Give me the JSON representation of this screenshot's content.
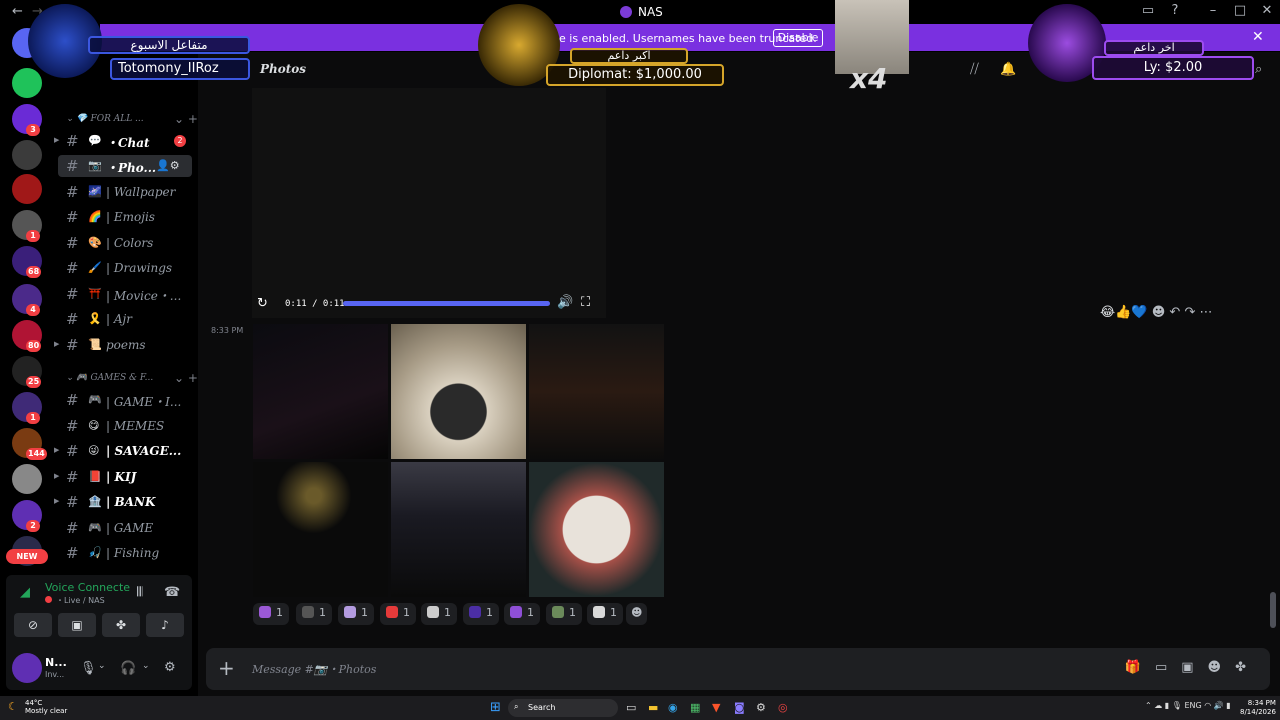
{
  "window": {
    "title": "NAS",
    "back": "←",
    "forward": "→"
  },
  "banner": {
    "text": "e is enabled. Usernames have been truncated.",
    "button": "Disable"
  },
  "rail": {
    "servers": [
      {
        "color": "#5865f2",
        "badge": ""
      },
      {
        "color": "#1fc25a",
        "badge": ""
      },
      {
        "color": "#6a2bd6",
        "badge": "3"
      },
      {
        "color": "#3b3b3b",
        "badge": ""
      },
      {
        "color": "#a01818",
        "badge": ""
      },
      {
        "color": "#555555",
        "badge": "1"
      },
      {
        "color": "#3a1f7a",
        "badge": "68"
      },
      {
        "color": "#4b2a8a",
        "badge": "4"
      },
      {
        "color": "#b01434",
        "badge": "80"
      },
      {
        "color": "#222222",
        "badge": "25"
      },
      {
        "color": "#3f2a77",
        "badge": "1"
      },
      {
        "color": "#7a3b12",
        "badge": "144"
      },
      {
        "color": "#888888",
        "badge": ""
      },
      {
        "color": "#5f2fb3",
        "badge": "2"
      },
      {
        "color": "#2a2a4a",
        "badge": ""
      }
    ],
    "new_label": "NEW"
  },
  "sidebar": {
    "cat1": "FOR ALL ...",
    "cat2": "GAMES & F...",
    "channels": [
      {
        "emoji": "💬",
        "name": "・Chat",
        "bold": true,
        "badge": "2",
        "active": false,
        "arrow": true
      },
      {
        "emoji": "📷",
        "name": "・Pho...",
        "bold": true,
        "badge": "",
        "active": true,
        "arrow": false
      },
      {
        "emoji": "🌌",
        "name": "| Wallpaper",
        "bold": false,
        "badge": "",
        "active": false,
        "arrow": false
      },
      {
        "emoji": "🌈",
        "name": "| Emojis",
        "bold": false,
        "badge": "",
        "active": false,
        "arrow": false
      },
      {
        "emoji": "🎨",
        "name": "| Colors",
        "bold": false,
        "badge": "",
        "active": false,
        "arrow": false
      },
      {
        "emoji": "🖌️",
        "name": "| Drawings",
        "bold": false,
        "badge": "",
        "active": false,
        "arrow": false
      },
      {
        "emoji": "⛩️",
        "name": "| Movice・...",
        "bold": false,
        "badge": "",
        "active": false,
        "arrow": false
      },
      {
        "emoji": "🎗️",
        "name": "| Ajr",
        "bold": false,
        "badge": "",
        "active": false,
        "arrow": false
      },
      {
        "emoji": "📜",
        "name": "poems",
        "bold": false,
        "badge": "",
        "active": false,
        "arrow": true
      },
      {
        "emoji": "🎮",
        "name": "| GAME・I...",
        "bold": false,
        "badge": "",
        "active": false,
        "arrow": false
      },
      {
        "emoji": "😋",
        "name": "| MEMES",
        "bold": false,
        "badge": "",
        "active": false,
        "arrow": false
      },
      {
        "emoji": "😜",
        "name": "| SAVAGE...",
        "bold": true,
        "badge": "",
        "active": false,
        "arrow": true
      },
      {
        "emoji": "📕",
        "name": "| KIJ",
        "bold": true,
        "badge": "",
        "active": false,
        "arrow": true
      },
      {
        "emoji": "🏦",
        "name": "| BANK",
        "bold": true,
        "badge": "",
        "active": false,
        "arrow": true
      },
      {
        "emoji": "🎮",
        "name": "| GAME",
        "bold": false,
        "badge": "",
        "active": false,
        "arrow": false
      },
      {
        "emoji": "🎣",
        "name": "| Fishing",
        "bold": false,
        "badge": "",
        "active": false,
        "arrow": false
      }
    ]
  },
  "voice": {
    "title": "Voice Connecte",
    "sub": "・Live / NAS"
  },
  "user": {
    "name": "N...",
    "status": "Inv..."
  },
  "header": {
    "channel": "Photos"
  },
  "video": {
    "time": "0:11 / 0:11",
    "progress": 1.0
  },
  "message": {
    "timestamp": "8:33 PM",
    "tiles": [
      {
        "bg": "linear-gradient(160deg,#0b0b10,#1a1018 60%,#050505)"
      },
      {
        "bg": "radial-gradient(circle at 50% 65%,#2a2a2a 0 25%,#d9d0bf 26%,#a79b86 60%,#6a604f)"
      },
      {
        "bg": "linear-gradient(180deg,#121212,#2a1a12 50%,#0c0c0c)"
      },
      {
        "bg": "radial-gradient(circle at 45% 25%,#6a5a2a 0 6%,#0a0a0a 30%)"
      },
      {
        "bg": "linear-gradient(180deg,#3a3a44,#1a1a22 40%,#0a0a0a)"
      },
      {
        "bg": "radial-gradient(circle at 50% 50%,#e8e2da 0 35%,#a65048 36%,#202a2a 70%)"
      }
    ]
  },
  "reactions": [
    {
      "color": "#9b59d6",
      "count": "1"
    },
    {
      "color": "#555555",
      "count": "1"
    },
    {
      "color": "#b39be0",
      "count": "1"
    },
    {
      "color": "#e53a3a",
      "count": "1"
    },
    {
      "color": "#cccccc",
      "count": "1"
    },
    {
      "color": "#4b2ea5",
      "count": "1"
    },
    {
      "color": "#8e4fd6",
      "count": "1"
    },
    {
      "color": "#6b8a5a",
      "count": "1"
    },
    {
      "color": "#d9d9d9",
      "count": "1"
    }
  ],
  "composer": {
    "placeholder": "Message #📷・Photos"
  },
  "overlays": {
    "left_title": "متفاعل الاسبوع",
    "left_name": "Totomony_IIRoz",
    "center_title": "اكبر داعم",
    "center_name": "Diplomat: $1,000.00",
    "right_title": "اخر داعم",
    "right_name": "Ly: $2.00",
    "multiplier": "x4"
  },
  "taskbar": {
    "temp": "44°C",
    "weather": "Mostly clear",
    "search": "Search",
    "lang": "ENG",
    "time": "8:34 PM",
    "date": "8/14/2026"
  }
}
